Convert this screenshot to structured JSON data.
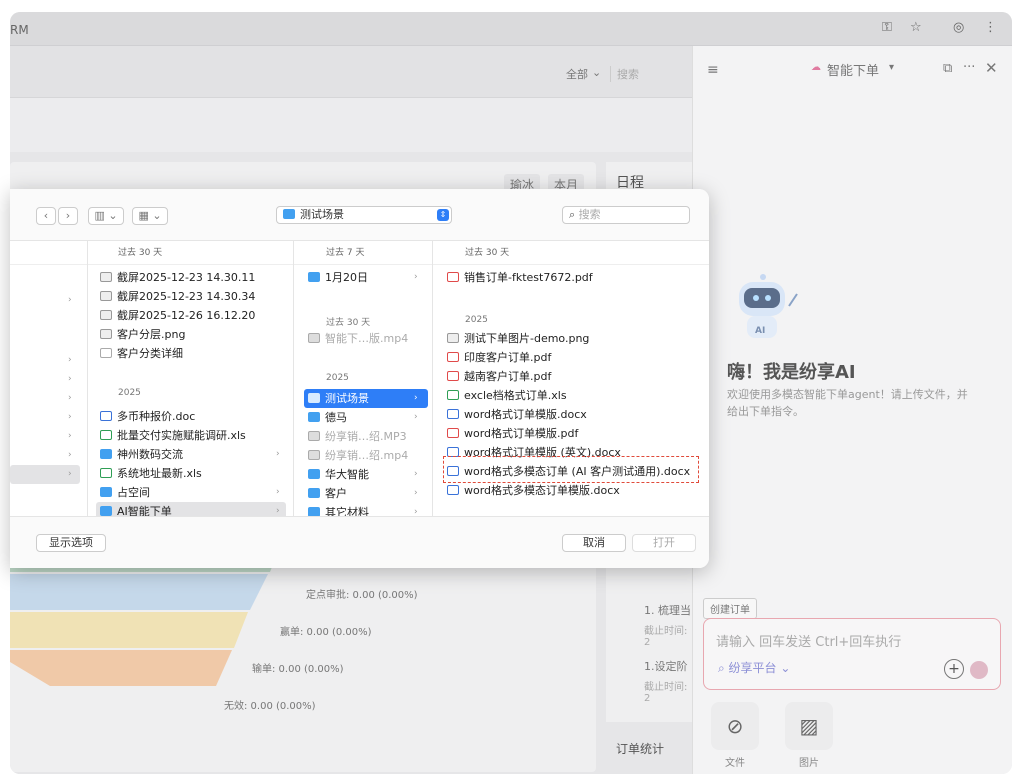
{
  "browser": {
    "url_fragment": "RM"
  },
  "background": {
    "scope_filter": "全部",
    "search": "搜索",
    "pill_user": "瑜冰",
    "pill_period": "本月",
    "schedule_title": "日程",
    "funnel": {
      "approval": "定点审批: 0.00 (0.00%)",
      "win": "赢单: 0.00 (0.00%)",
      "lose": "输单: 0.00 (0.00%)",
      "invalid": "无效: 0.00 (0.00%)"
    },
    "task1_title": "1. 梳理当",
    "task1_due": "截止时间: 2",
    "task2_title": "1.设定阶",
    "task2_due": "截止时间: 2",
    "order_stats": "订单统计"
  },
  "ai_panel": {
    "title": "智能下单",
    "greeting": "嗨！我是纷享AI",
    "subtitle": "欢迎使用多模态智能下单agent！请上传文件，并给出下单指令。",
    "create_order_chip": "创建订单",
    "input_placeholder": "请输入 回车发送 Ctrl+回车执行",
    "platform": "纷享平台",
    "tool_file": "文件",
    "tool_image": "图片",
    "robot_label": "AI"
  },
  "dialog": {
    "path": "测试场景",
    "search_placeholder": "搜索",
    "col2_head": "过去 30 天",
    "col3_head": "过去 7 天",
    "col4_head": "过去 30 天",
    "col2_items_recent": [
      "截屏2025-12-23 14.30.11",
      "截屏2025-12-23 14.30.34",
      "截屏2025-12-26 16.12.20",
      "客户分层.png",
      "客户分类详细"
    ],
    "col2_sec_2025": "2025",
    "col2_items_2025": [
      "多币种报价.doc",
      "批量交付实施赋能调研.xls",
      "神州数码交流",
      "系统地址最新.xls",
      "占空间",
      "AI智能下单"
    ],
    "col3_items_recent": [
      "1月20日"
    ],
    "col3_sec_30": "过去 30 天",
    "col3_items_30": [
      "智能下…版.mp4"
    ],
    "col3_sec_2025": "2025",
    "col3_items_2025": [
      "测试场景",
      "德马",
      "纷享销…绍.MP3",
      "纷享销…绍.mp4",
      "华大智能",
      "客户",
      "其它材料"
    ],
    "col4_items_recent": [
      "销售订单-fktest7672.pdf"
    ],
    "col4_sec_2025": "2025",
    "col4_items_2025": [
      "测试下单图片-demo.png",
      "印度客户订单.pdf",
      "越南客户订单.pdf",
      "excle档格式订单.xls",
      "word格式订单模版.docx",
      "word格式订单模版.pdf",
      "word格式订单模版 (英文).docx",
      "word格式多模态订单 (AI 客户测试通用).docx",
      "word格式多模态订单模版.docx"
    ],
    "show_options": "显示选项",
    "cancel": "取消",
    "open": "打开"
  }
}
